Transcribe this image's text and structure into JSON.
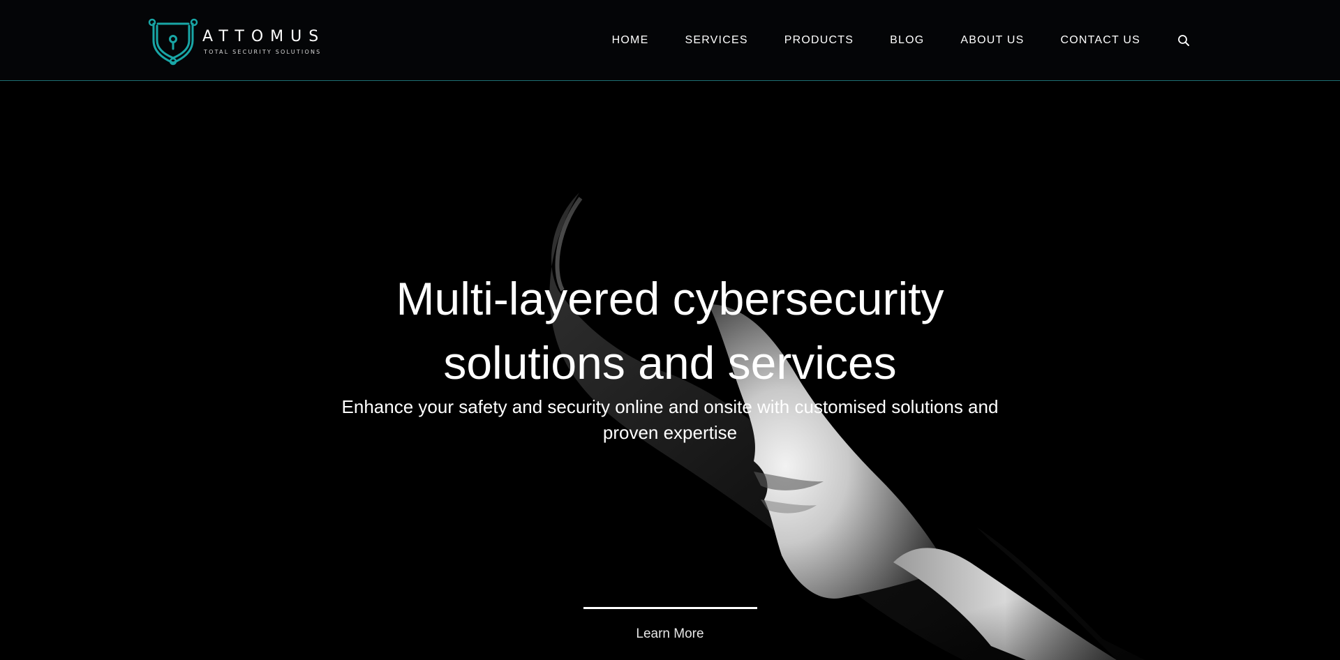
{
  "brand": {
    "name": "ATTOMUS",
    "tagline": "TOTAL SECURITY SOLUTIONS",
    "accent_color": "#1aa3a3"
  },
  "nav": {
    "items": [
      {
        "label": "HOME"
      },
      {
        "label": "SERVICES"
      },
      {
        "label": "PRODUCTS"
      },
      {
        "label": "BLOG"
      },
      {
        "label": "ABOUT US"
      },
      {
        "label": "CONTACT US"
      }
    ],
    "search_icon": "search-icon"
  },
  "hero": {
    "title_line1": "Multi-layered cybersecurity",
    "title_line2": "solutions and services",
    "subtitle_line1": "Enhance your safety and security online and onsite with customised solutions and",
    "subtitle_line2": "proven expertise",
    "cta_label": "Learn More",
    "background": "#000000",
    "image": "hooded-face-image"
  }
}
